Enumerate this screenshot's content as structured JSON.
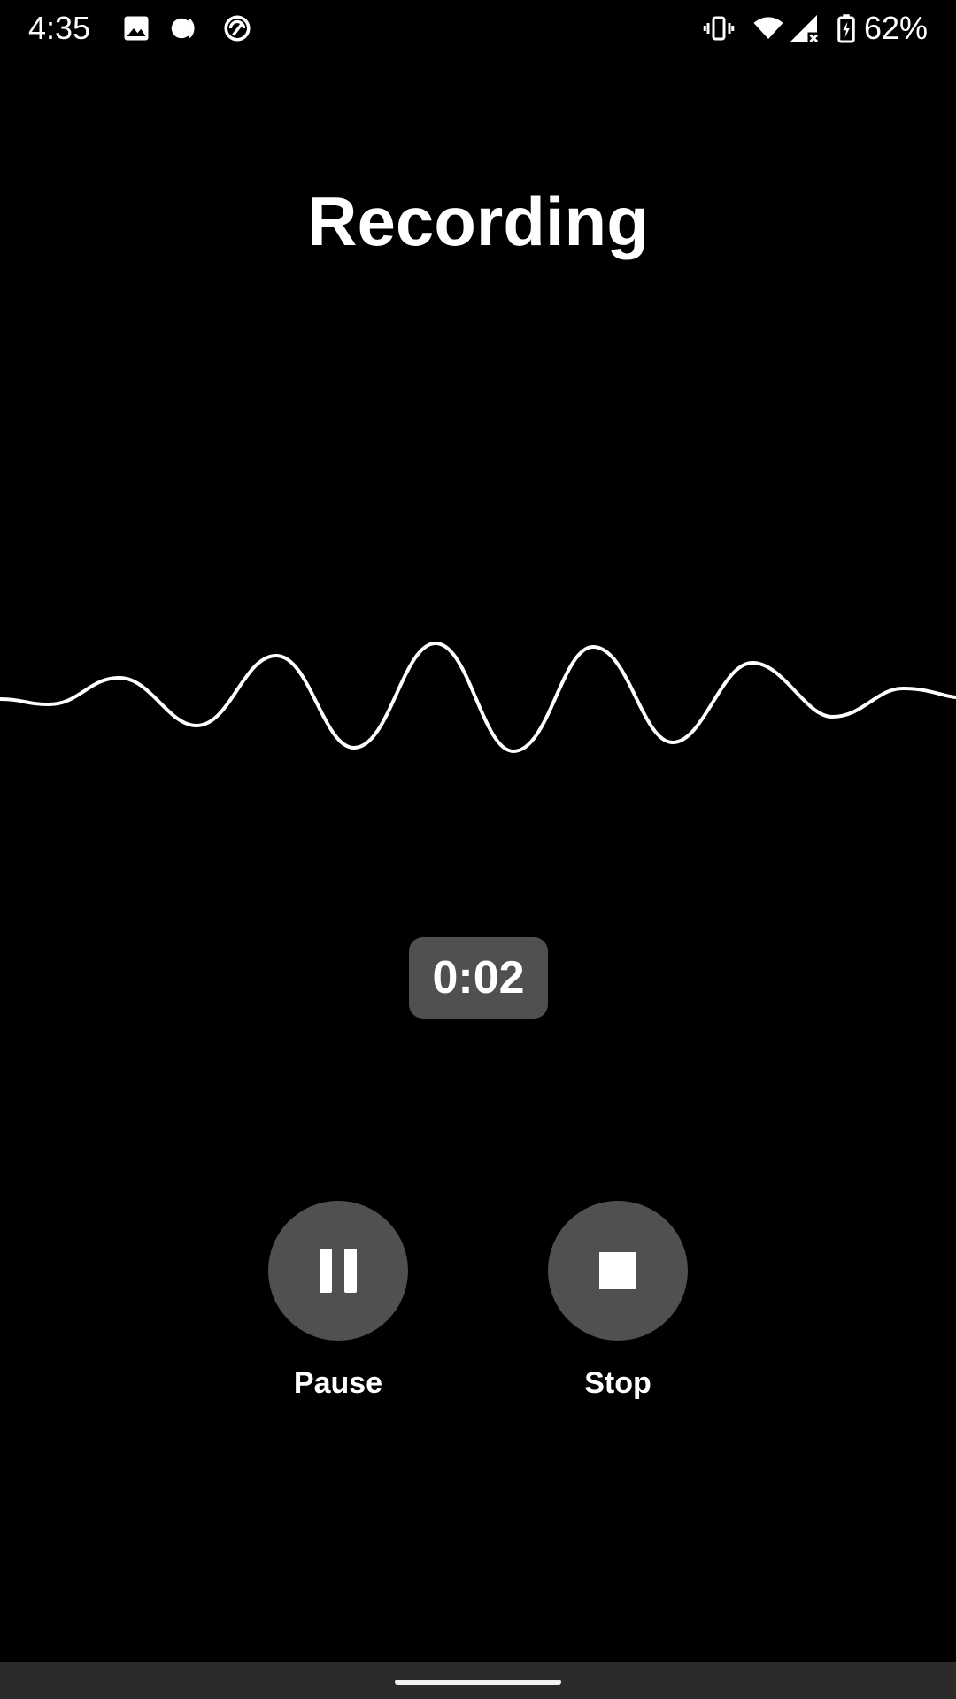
{
  "status_bar": {
    "time": "4:35",
    "icons_left": [
      "image-icon",
      "data-saver-icon",
      "sync-icon"
    ],
    "icons_right": [
      "vibrate-icon",
      "wifi-icon",
      "signal-no-service-icon",
      "battery-charging-icon"
    ],
    "battery_percent": "62%"
  },
  "screen": {
    "title": "Recording",
    "timer": "0:02"
  },
  "controls": {
    "pause_label": "Pause",
    "stop_label": "Stop"
  },
  "colors": {
    "background": "#000000",
    "button_fill": "#4f5052",
    "foreground": "#ffffff",
    "nav_bar": "#2b2b2b"
  }
}
